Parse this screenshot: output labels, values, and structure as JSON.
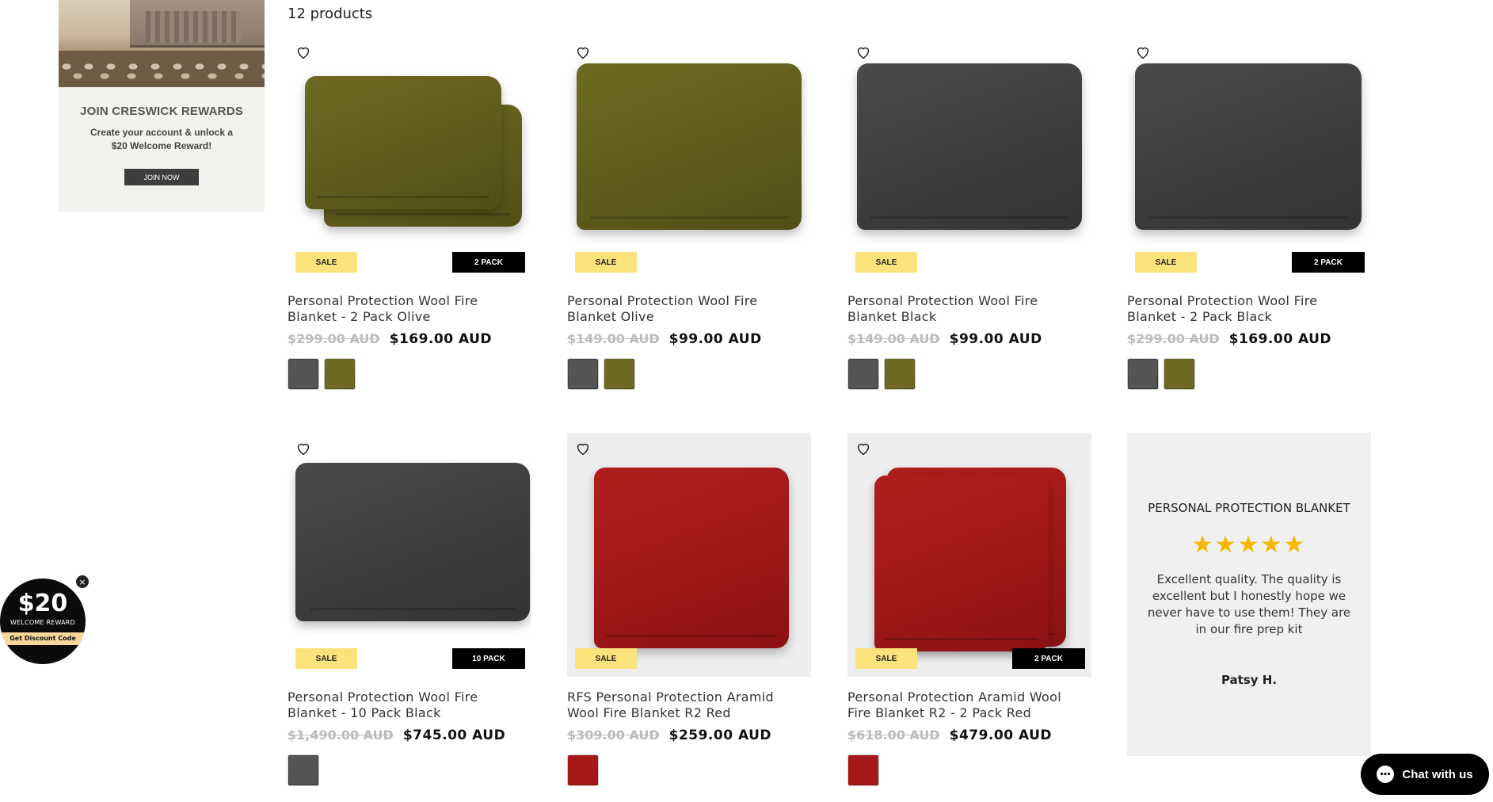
{
  "sidebar": {
    "promo_title": "JOIN CRESWICK REWARDS",
    "promo_text": "Create your account & unlock a $20 Welcome Reward!",
    "promo_button": "JOIN NOW"
  },
  "results": {
    "count_label": "12 products"
  },
  "products": [
    {
      "title": "Personal Protection Wool Fire Blanket - 2 Pack Olive",
      "was": "$299.00 AUD",
      "now": "$169.00 AUD",
      "sale": "SALE",
      "pack": "2 PACK",
      "swatches": [
        "black",
        "olive"
      ]
    },
    {
      "title": "Personal Protection Wool Fire Blanket Olive",
      "was": "$149.00 AUD",
      "now": "$99.00 AUD",
      "sale": "SALE",
      "pack": "",
      "swatches": [
        "black",
        "olive"
      ]
    },
    {
      "title": "Personal Protection Wool Fire Blanket Black",
      "was": "$149.00 AUD",
      "now": "$99.00 AUD",
      "sale": "SALE",
      "pack": "",
      "swatches": [
        "black",
        "olive"
      ]
    },
    {
      "title": "Personal Protection Wool Fire Blanket - 2 Pack Black",
      "was": "$299.00 AUD",
      "now": "$169.00 AUD",
      "sale": "SALE",
      "pack": "2 PACK",
      "swatches": [
        "black",
        "olive"
      ]
    },
    {
      "title": "Personal Protection Wool Fire Blanket - 10 Pack Black",
      "was": "$1,490.00 AUD",
      "now": "$745.00 AUD",
      "sale": "SALE",
      "pack": "10 PACK",
      "swatches": [
        "black"
      ]
    },
    {
      "title": "RFS Personal Protection Aramid Wool Fire Blanket R2 Red",
      "was": "$309.00 AUD",
      "now": "$259.00 AUD",
      "sale": "SALE",
      "pack": "",
      "swatches": [
        "red"
      ]
    },
    {
      "title": "Personal Protection Aramid Wool Fire Blanket R2 - 2 Pack Red",
      "was": "$618.00 AUD",
      "now": "$479.00 AUD",
      "sale": "SALE",
      "pack": "2 PACK",
      "swatches": [
        "red"
      ]
    }
  ],
  "review": {
    "title": "PERSONAL PROTECTION BLANKET",
    "stars": "★★★★★",
    "text": "Excellent quality. The quality is excellent but I honestly hope we never have to use them! They are in our fire prep kit",
    "author": "Patsy H."
  },
  "reward_popup": {
    "amount": "$20",
    "label": "WELCOME REWARD",
    "code_button": "Get Discount Code",
    "close": "×"
  },
  "chat": {
    "label": "Chat with us"
  },
  "colors": {
    "sale_badge": "#fbe27a",
    "pack_badge": "#000000",
    "star": "#f5b800"
  }
}
